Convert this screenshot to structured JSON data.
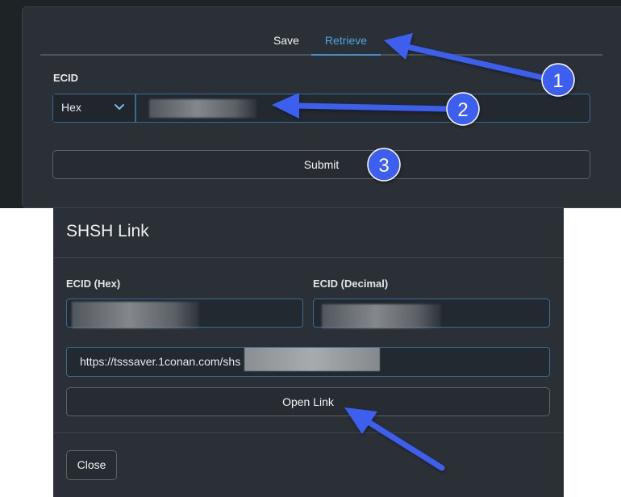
{
  "tabs": {
    "save_label": "Save",
    "retrieve_label": "Retrieve",
    "active": "Retrieve"
  },
  "form": {
    "ecid_label": "ECID",
    "format_selected": "Hex",
    "ecid_value": "",
    "submit_label": "Submit"
  },
  "modal": {
    "title": "SHSH Link",
    "ecid_hex_label": "ECID (Hex)",
    "ecid_decimal_label": "ECID (Decimal)",
    "ecid_hex_value": "",
    "ecid_decimal_value": "",
    "link_value": "https://tsssaver.1conan.com/shs",
    "open_link_label": "Open Link",
    "close_label": "Close"
  },
  "annotations": {
    "step_1": "1",
    "step_2": "2",
    "step_3": "3",
    "color": "#3d5ef0"
  },
  "icons": {
    "select_chevron": "chevron-down-icon"
  },
  "colors": {
    "accent_blue": "#4fa3e0",
    "panel_bg": "#2a3035",
    "outer_bg": "#1e2326",
    "input_border": "#3a6a96",
    "button_border": "#5b636a"
  }
}
